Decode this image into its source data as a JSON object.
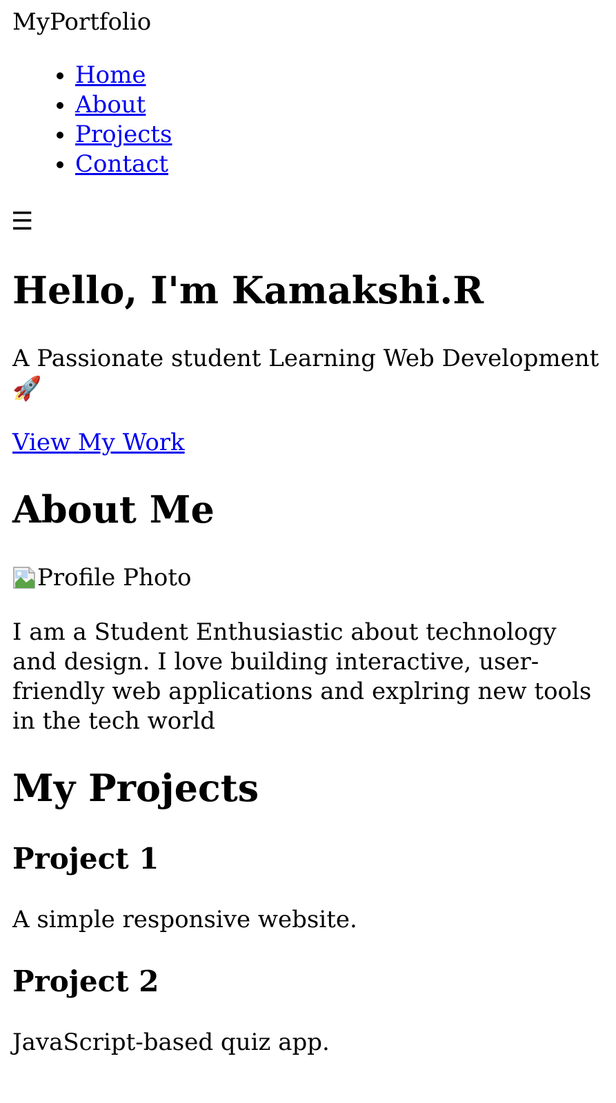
{
  "header": {
    "logo": "MyPortfolio",
    "nav": [
      {
        "label": "Home"
      },
      {
        "label": "About"
      },
      {
        "label": "Projects"
      },
      {
        "label": "Contact"
      }
    ],
    "menu_toggle": "☰"
  },
  "hero": {
    "title": "Hello, I'm Kamakshi.R",
    "subtitle": "A Passionate student Learning Web Development",
    "rocket_emoji": "🚀",
    "cta": "View My Work"
  },
  "about": {
    "title": "About Me",
    "profile_alt": "Profile Photo",
    "text": "I am a Student Enthusiastic about technology and design. I love building interactive, user-friendly web applications and explring new tools in the tech world"
  },
  "projects": {
    "title": "My Projects",
    "items": [
      {
        "title": "Project 1",
        "description": "A simple responsive website."
      },
      {
        "title": "Project 2",
        "description": "JavaScript-based quiz app."
      }
    ]
  },
  "colors": {
    "link": "#0000EE",
    "text": "#000000",
    "background": "#FFFFFF"
  },
  "icons": {
    "menu": "hamburger-menu-icon",
    "broken_image": "broken-image-icon",
    "rocket": "rocket-icon"
  }
}
